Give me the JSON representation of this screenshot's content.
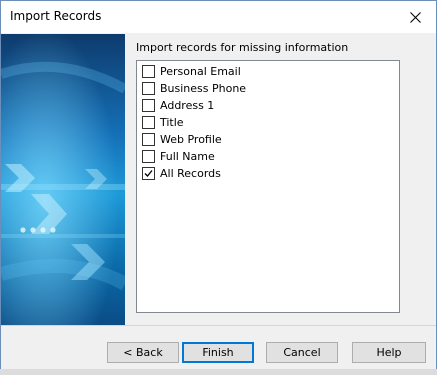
{
  "window": {
    "title": "Import Records"
  },
  "main": {
    "label": "Import records for missing information",
    "items": [
      {
        "label": "Personal Email",
        "checked": false
      },
      {
        "label": "Business Phone",
        "checked": false
      },
      {
        "label": "Address 1",
        "checked": false
      },
      {
        "label": "Title",
        "checked": false
      },
      {
        "label": "Web Profile",
        "checked": false
      },
      {
        "label": "Full Name",
        "checked": false
      },
      {
        "label": "All Records",
        "checked": true
      }
    ]
  },
  "buttons": {
    "back": "< Back",
    "finish": "Finish",
    "cancel": "Cancel",
    "help": "Help"
  }
}
